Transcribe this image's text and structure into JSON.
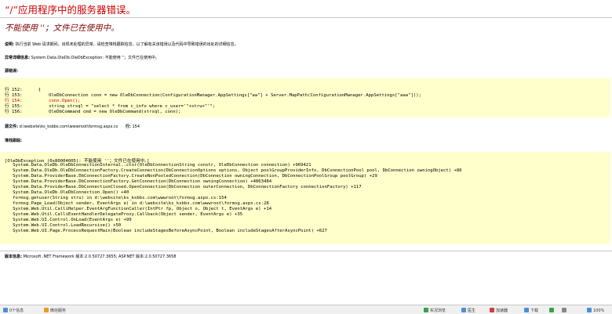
{
  "page": {
    "title": "“/”应用程序中的服务器错误。",
    "subtitle": "不能使用 ''；文件已在使用中。",
    "description_label": "说明:",
    "description": "执行当前 Web 请求期间，出现未处理的异常。请检查堆栈跟踪信息，以了解有关该错误以及代码中导致错误的出处的详细信息。",
    "exception_label": "异常详细信息:",
    "exception": "System.Data.OleDb.OleDbException: 不能使用 ''；文件已在使用中。",
    "source_error_label": "源错误:",
    "source_file_label": "源文件:",
    "source_file": "d:\\website\\ks_ksbbs.com\\wwwroot\\formsg.aspx.cs",
    "line_label": "行:",
    "line_number": "154",
    "stack_label": "堆栈跟踪:",
    "version_label": "版本信息:",
    "version": "Microsoft .NET Framework 版本:2.0.50727.3655; ASP.NET 版本:2.0.50727.3658"
  },
  "source_code": [
    {
      "text": "行 152:      {",
      "error": false
    },
    {
      "text": "行 153:          OleDbConnection conn = new OleDbConnection(ConfigurationManager.AppSettings[\"aa\"] + Server.MapPath(ConfigurationManager.AppSettings[\"aaa\"]));",
      "error": false
    },
    {
      "text": "行 154:          conn.Open();",
      "error": true
    },
    {
      "text": "行 155:          string strsql = \"select * from c_info where c_user='\"+stru+\"'\";",
      "error": false
    },
    {
      "text": "行 156:          OleDbCommand cmd = new OleDbCommand(strsql, conn);",
      "error": false
    }
  ],
  "stack_trace": [
    "[OleDbException (0x80004005): 不能使用 ''；文件已在使用中。]",
    "   System.Data.OleDb.OleDbConnectionInternal..ctor(OleDbConnectionString constr, OleDbConnection connection) +969421",
    "   System.Data.OleDb.OleDbConnectionFactory.CreateConnection(DbConnectionOptions options, Object poolGroupProviderInfo, DbConnectionPool pool, DbConnection owningObject) +86",
    "   System.Data.ProviderBase.DbConnectionFactory.CreateNonPooledConnection(DbConnection owningConnection, DbConnectionPoolGroup poolGroup) +29",
    "   System.Data.ProviderBase.DbConnectionFactory.GetConnection(DbConnection owningConnection) +4863484",
    "   System.Data.ProviderBase.DbConnectionClosed.OpenConnection(DbConnection outerConnection, DbConnectionFactory connectionFactory) +117",
    "   System.Data.OleDb.OleDbConnection.Open() +40",
    "   formsg.getuser(String stru) in d:\\website\\ks_ksbbs.com\\wwwroot\\formsg.aspx.cs:154",
    "   formsg.Page_Load(Object sender, EventArgs e) in d:\\website\\ks_ksbbs.com\\wwwroot\\formsg.aspx.cs:28",
    "   System.Web.Util.CalliHelper.EventArgFunctionCaller(IntPtr fp, Object o, Object t, EventArgs e) +14",
    "   System.Web.Util.CalliEventHandlerDelegateProxy.Callback(Object sender, EventArgs e) +35",
    "   System.Web.UI.Control.OnLoad(EventArgs e) +99",
    "   System.Web.UI.Control.LoadRecursive() +50",
    "   System.Web.UI.Page.ProcessRequestMain(Boolean includeStagesBeforeAsyncPoint, Boolean includeStagesAfterAsyncPoint) +627"
  ],
  "taskbar": {
    "left_items": [
      "0个信息",
      "微信服务"
    ],
    "right_items": [
      "实况浏览",
      "医生",
      "加速器",
      "下载",
      "100%"
    ],
    "icon_colors": [
      "#4a8fd8",
      "#e0a020",
      "#3aa04a",
      "#4a8fd8",
      "#d04040",
      "#4a8fd8",
      "#3aa04a"
    ]
  }
}
